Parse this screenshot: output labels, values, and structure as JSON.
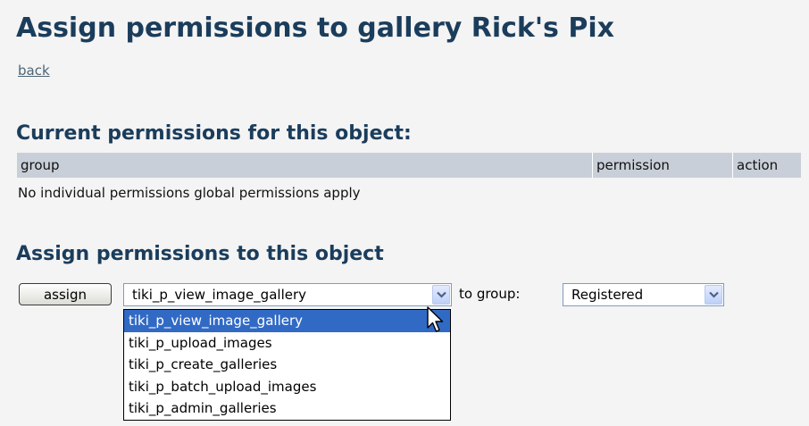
{
  "page": {
    "title": "Assign permissions to gallery Rick's Pix",
    "back_link": "back"
  },
  "current_permissions": {
    "heading": "Current permissions for this object:",
    "columns": [
      "group",
      "permission",
      "action"
    ],
    "empty_message": "No individual permissions global permissions apply"
  },
  "assign_section": {
    "heading": "Assign permissions to this object",
    "assign_button": "assign",
    "permission_select": {
      "value": "tiki_p_view_image_gallery",
      "expanded": true,
      "options": [
        "tiki_p_view_image_gallery",
        "tiki_p_upload_images",
        "tiki_p_create_galleries",
        "tiki_p_batch_upload_images",
        "tiki_p_admin_galleries"
      ],
      "highlighted_option": "tiki_p_view_image_gallery"
    },
    "to_group_label": "to group:",
    "group_select": {
      "value": "Registered"
    }
  },
  "icons": {
    "dropdown_arrow": "chevron-down-icon",
    "cursor": "mouse-pointer-icon"
  },
  "colors": {
    "heading": "#1b3d5c",
    "table_header_bg": "#c9cfd8",
    "selection": "#316ac5",
    "page_bg": "#f4f4f4"
  }
}
